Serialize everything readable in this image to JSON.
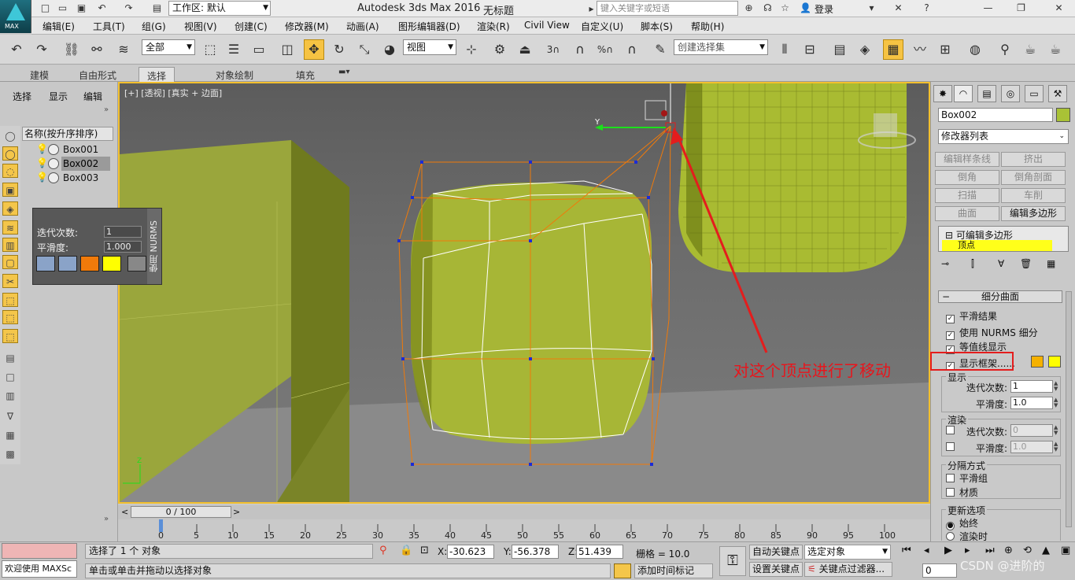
{
  "titlebar": {
    "logo_text": "MAX",
    "workspace": "工作区: 默认",
    "app_title": "Autodesk 3ds Max 2016",
    "doc_title": "无标题",
    "search_placeholder": "键入关键字或短语",
    "login": "登录"
  },
  "menu": [
    "编辑(E)",
    "工具(T)",
    "组(G)",
    "视图(V)",
    "创建(C)",
    "修改器(M)",
    "动画(A)",
    "图形编辑器(D)",
    "渲染(R)",
    "Civil View",
    "自定义(U)",
    "脚本(S)",
    "帮助(H)"
  ],
  "toolbar": {
    "filter": "全部",
    "ref_coord": "视图",
    "named_sel": "创建选择集",
    "num3": "3",
    "pct": "%"
  },
  "ribbon_tabs": [
    "建模",
    "自由形式",
    "选择",
    "对象绘制",
    "填充"
  ],
  "scene": {
    "tabs": [
      "选择",
      "显示",
      "编辑"
    ],
    "header": "名称(按升序排序)",
    "items": [
      "Box001",
      "Box002",
      "Box003"
    ]
  },
  "nurms": {
    "iter_label": "迭代次数:",
    "iter_value": "1",
    "smooth_label": "平滑度:",
    "smooth_value": "1.000",
    "vertical_label": "使用 NURMS",
    "color1": "#f07a0a",
    "color2": "#ffff00"
  },
  "viewport": {
    "label": "[+] [透视] [真实 + 边面]",
    "annotation": "对这个顶点进行了移动",
    "axis_x": "X",
    "axis_y": "Y",
    "axis_z": "Z"
  },
  "command": {
    "object_name": "Box002",
    "object_color": "#a9c236",
    "modifier_list": "修改器列表",
    "mod_buttons": [
      "编辑样条线",
      "挤出",
      "倒角",
      "倒角剖面",
      "扫描",
      "车削",
      "曲面",
      "编辑多边形"
    ],
    "stack_top": "可编辑多边形",
    "stack_sub": "顶点",
    "rollout": "细分曲面",
    "smooth_result": "平滑结果",
    "use_nurms": "使用 NURMS 细分",
    "isoline": "等值线显示",
    "show_cage": "显示框架......",
    "cage_color1": "#f5b100",
    "cage_color2": "#ffff00",
    "display_group": "显示",
    "iterations": "迭代次数:",
    "iter_val": "1",
    "smoothness": "平滑度:",
    "smooth_val": "1.0",
    "render_group": "渲染",
    "r_iter_val": "0",
    "r_smooth_val": "1.0",
    "sep_group": "分隔方式",
    "smooth_group": "平滑组",
    "material": "材质",
    "update_group": "更新选项",
    "always": "始终",
    "when_render": "渲染时"
  },
  "timeline": {
    "frame": "0 / 100",
    "ticks": [
      "0",
      "5",
      "10",
      "15",
      "20",
      "25",
      "30",
      "35",
      "40",
      "45",
      "50",
      "55",
      "60",
      "65",
      "70",
      "75",
      "80",
      "85",
      "90",
      "95",
      "100"
    ]
  },
  "status": {
    "maxscript": "欢迎使用 MAXSc",
    "line1": "选择了 1 个 对象",
    "line2": "单击或单击并拖动以选择对象",
    "x_label": "X:",
    "x": "-30.623",
    "y_label": "Y:",
    "y": "-56.378",
    "z_label": "Z:",
    "z": "51.439",
    "grid": "栅格 = 10.0",
    "auto_key": "自动关键点",
    "set_key": "设置关键点",
    "selected_obj": "选定对象",
    "key_filter": "关键点过滤器...",
    "add_time_tag": "添加时间标记",
    "frame_box": "0",
    "watermark": "CSDN @进阶的"
  }
}
